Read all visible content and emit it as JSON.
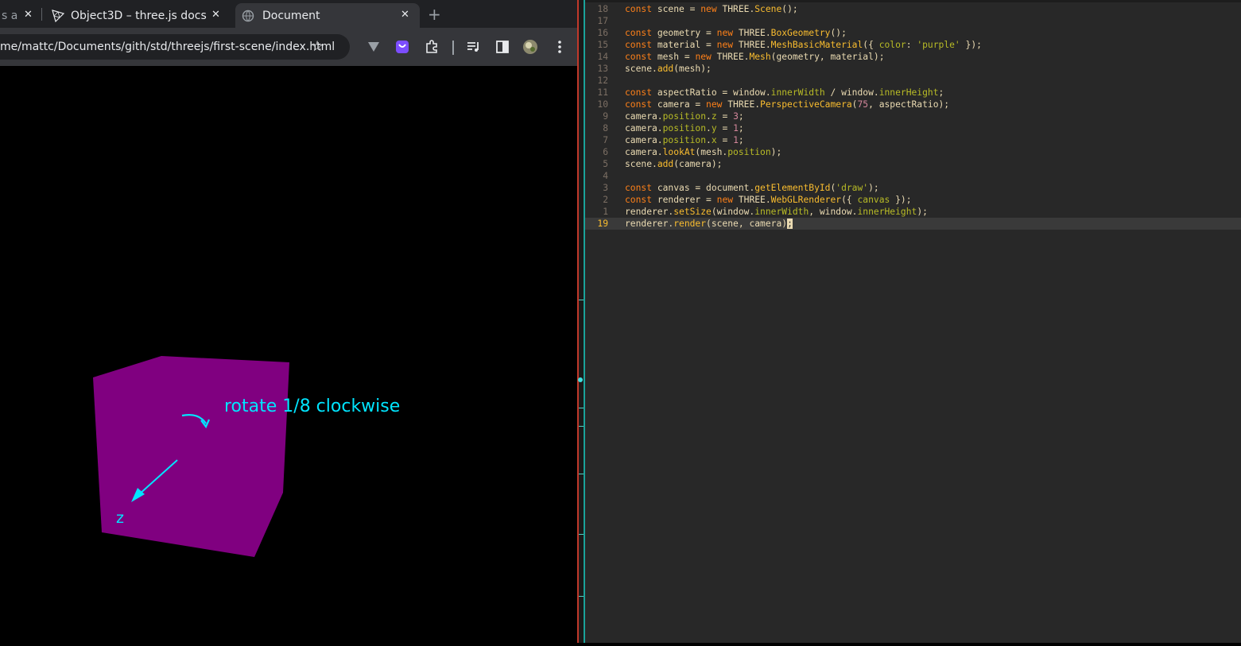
{
  "browser": {
    "tabs": [
      {
        "label": "s a",
        "close": "✕"
      },
      {
        "label": "Object3D – three.js docs",
        "close": "✕"
      },
      {
        "label": "Document",
        "close": "✕"
      }
    ],
    "new_tab": "+",
    "url": "me/mattc/Documents/gith/std/threejs/first-scene/index.html",
    "icons": [
      "bookmark-star-icon",
      "extension-v-icon",
      "extension-purple-icon",
      "extensions-puzzle-icon",
      "media-control-icon",
      "side-panel-icon",
      "profile-avatar-icon",
      "menu-kebab-icon"
    ]
  },
  "scene": {
    "annotation": "rotate 1/8 clockwise",
    "axis_label": "z",
    "cube_color": "#800080",
    "annotation_color": "#00e5ff"
  },
  "editor": {
    "lines": [
      {
        "n": "18",
        "parts": [
          [
            "kw",
            "const"
          ],
          [
            "t",
            " scene = "
          ],
          [
            "kw",
            "new"
          ],
          [
            "t",
            " THREE."
          ],
          [
            "fn",
            "Scene"
          ],
          [
            "t",
            "();"
          ]
        ]
      },
      {
        "n": "17",
        "parts": []
      },
      {
        "n": "16",
        "parts": [
          [
            "kw",
            "const"
          ],
          [
            "t",
            " geometry = "
          ],
          [
            "kw",
            "new"
          ],
          [
            "t",
            " THREE."
          ],
          [
            "fn",
            "BoxGeometry"
          ],
          [
            "t",
            "();"
          ]
        ]
      },
      {
        "n": "15",
        "parts": [
          [
            "kw",
            "const"
          ],
          [
            "t",
            " material = "
          ],
          [
            "kw",
            "new"
          ],
          [
            "t",
            " THREE."
          ],
          [
            "fn",
            "MeshBasicMaterial"
          ],
          [
            "t",
            "({ "
          ],
          [
            "pr",
            "color"
          ],
          [
            "t",
            ": "
          ],
          [
            "st",
            "'purple'"
          ],
          [
            "t",
            " });"
          ]
        ]
      },
      {
        "n": "14",
        "parts": [
          [
            "kw",
            "const"
          ],
          [
            "t",
            " mesh = "
          ],
          [
            "kw",
            "new"
          ],
          [
            "t",
            " THREE."
          ],
          [
            "fn",
            "Mesh"
          ],
          [
            "t",
            "(geometry, material);"
          ]
        ]
      },
      {
        "n": "13",
        "parts": [
          [
            "t",
            "scene."
          ],
          [
            "fn",
            "add"
          ],
          [
            "t",
            "(mesh);"
          ]
        ]
      },
      {
        "n": "12",
        "parts": []
      },
      {
        "n": "11",
        "parts": [
          [
            "kw",
            "const"
          ],
          [
            "t",
            " aspectRatio = window."
          ],
          [
            "pr",
            "innerWidth"
          ],
          [
            "t",
            " / window."
          ],
          [
            "pr",
            "innerHeight"
          ],
          [
            "t",
            ";"
          ]
        ]
      },
      {
        "n": "10",
        "parts": [
          [
            "kw",
            "const"
          ],
          [
            "t",
            " camera = "
          ],
          [
            "kw",
            "new"
          ],
          [
            "t",
            " THREE."
          ],
          [
            "fn",
            "PerspectiveCamera"
          ],
          [
            "t",
            "("
          ],
          [
            "nm",
            "75"
          ],
          [
            "t",
            ", aspectRatio);"
          ]
        ]
      },
      {
        "n": "9",
        "parts": [
          [
            "t",
            "camera."
          ],
          [
            "pr",
            "position"
          ],
          [
            "t",
            "."
          ],
          [
            "pr",
            "z"
          ],
          [
            "t",
            " = "
          ],
          [
            "nm",
            "3"
          ],
          [
            "t",
            ";"
          ]
        ]
      },
      {
        "n": "8",
        "parts": [
          [
            "t",
            "camera."
          ],
          [
            "pr",
            "position"
          ],
          [
            "t",
            "."
          ],
          [
            "pr",
            "y"
          ],
          [
            "t",
            " = "
          ],
          [
            "nm",
            "1"
          ],
          [
            "t",
            ";"
          ]
        ]
      },
      {
        "n": "7",
        "parts": [
          [
            "t",
            "camera."
          ],
          [
            "pr",
            "position"
          ],
          [
            "t",
            "."
          ],
          [
            "pr",
            "x"
          ],
          [
            "t",
            " = "
          ],
          [
            "nm",
            "1"
          ],
          [
            "t",
            ";"
          ]
        ]
      },
      {
        "n": "6",
        "parts": [
          [
            "t",
            "camera."
          ],
          [
            "fn",
            "lookAt"
          ],
          [
            "t",
            "(mesh."
          ],
          [
            "pr",
            "position"
          ],
          [
            "t",
            ");"
          ]
        ]
      },
      {
        "n": "5",
        "parts": [
          [
            "t",
            "scene."
          ],
          [
            "fn",
            "add"
          ],
          [
            "t",
            "(camera);"
          ]
        ]
      },
      {
        "n": "4",
        "parts": []
      },
      {
        "n": "3",
        "parts": [
          [
            "kw",
            "const"
          ],
          [
            "t",
            " canvas = document."
          ],
          [
            "fn",
            "getElementById"
          ],
          [
            "t",
            "("
          ],
          [
            "st",
            "'draw'"
          ],
          [
            "t",
            ");"
          ]
        ]
      },
      {
        "n": "2",
        "parts": [
          [
            "kw",
            "const"
          ],
          [
            "t",
            " renderer = "
          ],
          [
            "kw",
            "new"
          ],
          [
            "t",
            " THREE."
          ],
          [
            "fn",
            "WebGLRenderer"
          ],
          [
            "t",
            "({ "
          ],
          [
            "pr",
            "canvas"
          ],
          [
            "t",
            " });"
          ]
        ]
      },
      {
        "n": "1",
        "parts": [
          [
            "t",
            "renderer."
          ],
          [
            "fn",
            "setSize"
          ],
          [
            "t",
            "(window."
          ],
          [
            "pr",
            "innerWidth"
          ],
          [
            "t",
            ", window."
          ],
          [
            "pr",
            "innerHeight"
          ],
          [
            "t",
            ");"
          ]
        ]
      },
      {
        "n": "19",
        "current": true,
        "parts": [
          [
            "t",
            "renderer."
          ],
          [
            "fn",
            "render"
          ],
          [
            "t",
            "(scene, camera)"
          ],
          [
            "cur",
            ";"
          ]
        ]
      }
    ]
  }
}
